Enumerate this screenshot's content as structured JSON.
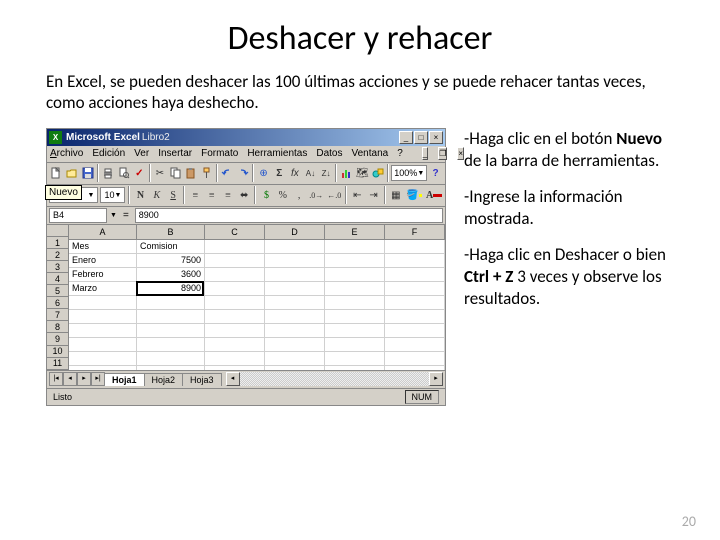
{
  "slide": {
    "title": "Deshacer y rehacer",
    "intro": "En Excel, se pueden deshacer las 100 últimas acciones y se puede rehacer tantas veces, como acciones haya deshecho.",
    "step1_pre": "-Haga clic en el botón ",
    "step1_bold": "Nuevo",
    "step1_post": " de la barra de herramientas.",
    "step2": "-Ingrese la información mostrada.",
    "step3_pre": "-Haga clic en Deshacer o bien ",
    "step3_bold": "Ctrl + Z",
    "step3_post": " 3 veces y observe los resultados.",
    "page_number": "20"
  },
  "app": {
    "name": "Microsoft Excel",
    "document": "Libro2",
    "tooltip": "Nuevo",
    "menus": {
      "archivo": "Archivo",
      "edicion": "Edición",
      "ver": "Ver",
      "insertar": "Insertar",
      "formato": "Formato",
      "herramientas": "Herramientas",
      "datos": "Datos",
      "ventana": "Ventana",
      "ayuda": "?"
    },
    "zoom": "100%",
    "font": "Arial",
    "font_size": "10",
    "active_cell": "B4",
    "formula_value": "8900",
    "columns": [
      "A",
      "B",
      "C",
      "D",
      "E",
      "F"
    ],
    "rows": [
      "1",
      "2",
      "3",
      "4",
      "5",
      "6",
      "7",
      "8",
      "9",
      "10",
      "11"
    ],
    "data": {
      "A1": "Mes",
      "B1": "Comision",
      "A2": "Enero",
      "B2": "7500",
      "A3": "Febrero",
      "B3": "3600",
      "A4": "Marzo",
      "B4": "8900"
    },
    "tabs": {
      "t1": "Hoja1",
      "t2": "Hoja2",
      "t3": "Hoja3"
    },
    "status": "Listo",
    "numlock": "NUM"
  }
}
